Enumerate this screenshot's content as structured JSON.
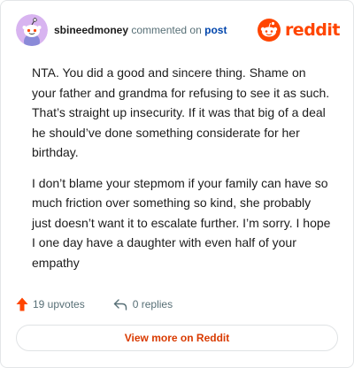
{
  "comment": {
    "username": "sbineedmoney",
    "action_text": "commented on",
    "post_link": "post",
    "paragraphs": [
      "NTA. You did a good and sincere thing. Shame on your father and grandma for refusing to see it as such. That’s straight up insecurity. If it was that big of a deal he should’ve done something considerate for her birthday.",
      "I don’t blame your stepmom if your family can have so much friction over something so kind, she probably just doesn’t want it to escalate further. I’m sorry. I hope I one day have a daughter with even half of your empathy"
    ],
    "upvotes": "19 upvotes",
    "replies": "0 replies"
  },
  "brand": {
    "name": "reddit",
    "icon": "reddit-snoo-icon",
    "color": "#ff4500"
  },
  "avatar": {
    "icon": "snoo-avatar-icon",
    "background": "#d8b4f0"
  },
  "view_more_label": "View more on Reddit"
}
